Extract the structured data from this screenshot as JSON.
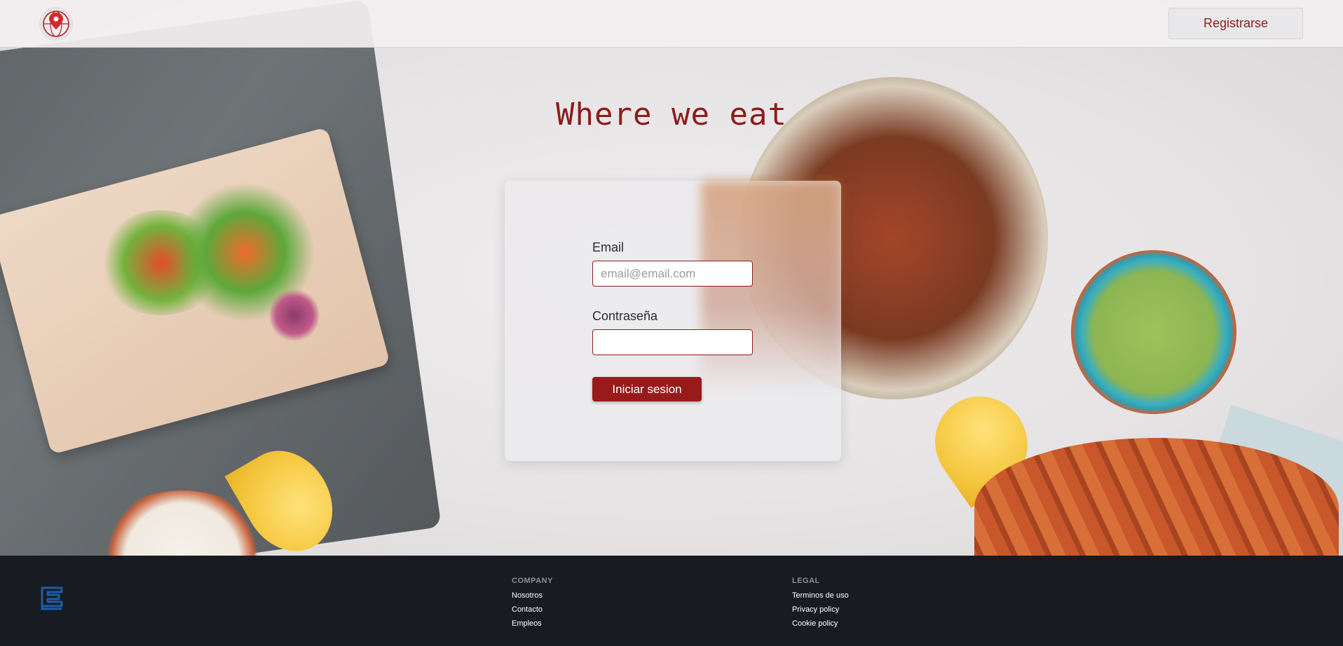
{
  "header": {
    "logo_icon": "map-pin-globe-icon",
    "register_label": "Registrarse"
  },
  "main": {
    "title": "Where we eat",
    "form": {
      "email_label": "Email",
      "email_placeholder": "email@email.com",
      "email_value": "",
      "password_label": "Contraseña",
      "password_value": "",
      "submit_label": "Iniciar sesion"
    }
  },
  "footer": {
    "logo_icon": "stacked-layers-logo-icon",
    "columns": [
      {
        "heading": "COMPANY",
        "links": [
          "Nosotros",
          "Contacto",
          "Empleos"
        ]
      },
      {
        "heading": "LEGAL",
        "links": [
          "Terminos de uso",
          "Privacy policy",
          "Cookie policy"
        ]
      }
    ]
  },
  "colors": {
    "accent": "#8e1b1b",
    "button": "#981b1b",
    "footer_bg": "#181b21",
    "footer_logo": "#1c5ea8"
  }
}
